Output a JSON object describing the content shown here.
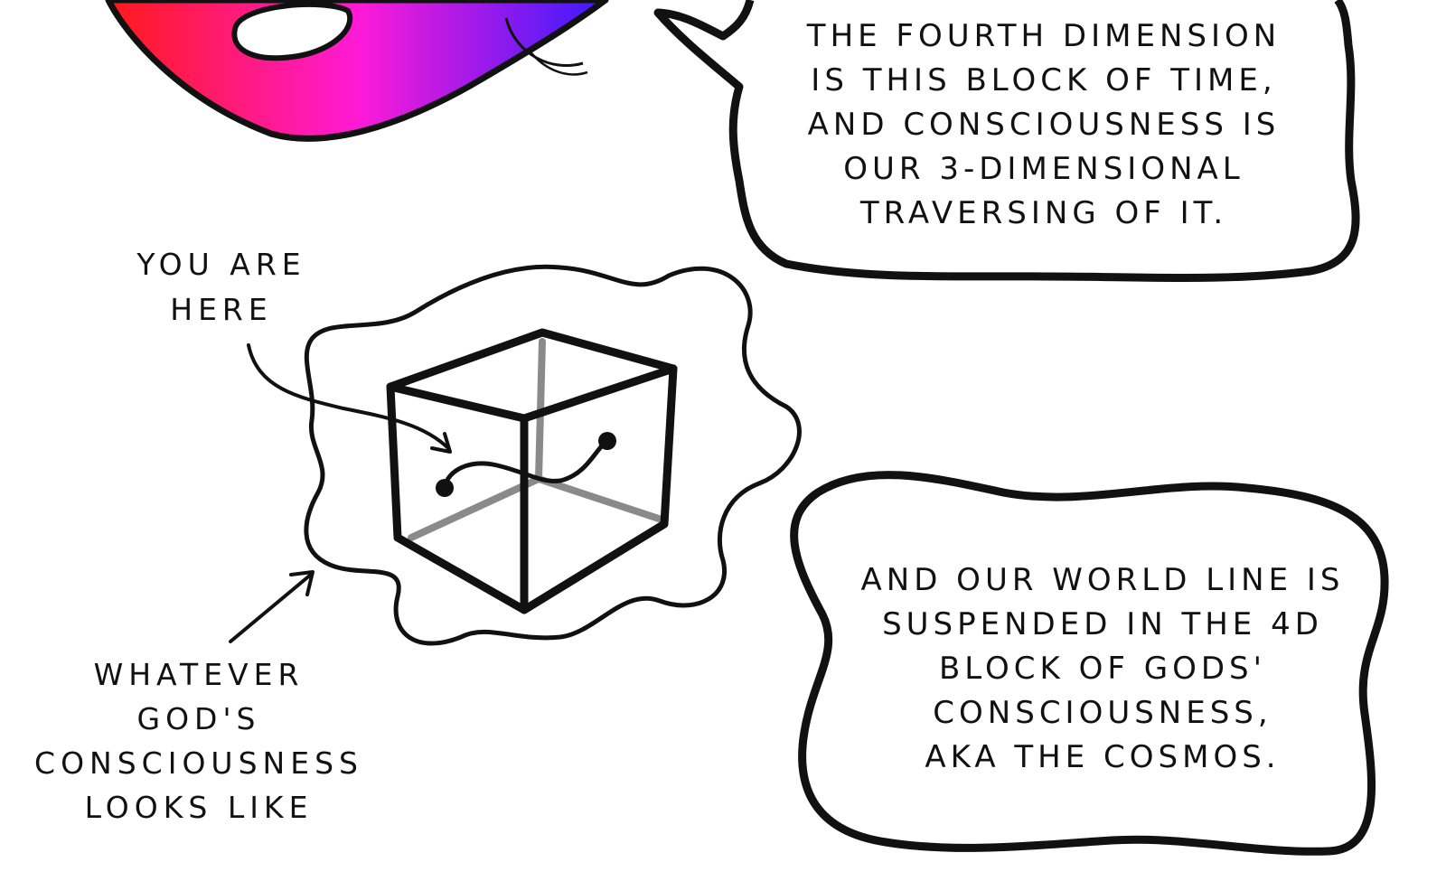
{
  "bubble_top": {
    "lines": [
      "THE FOURTH DIMENSION",
      "IS THIS BLOCK OF TIME,",
      "AND CONSCIOUSNESS IS",
      "OUR 3-DIMENSIONAL",
      "TRAVERSING OF IT."
    ]
  },
  "bubble_bottom": {
    "lines": [
      "AND OUR WORLD LINE IS",
      "SUSPENDED IN THE 4D",
      "BLOCK OF GODS'",
      "CONSCIOUSNESS,",
      "AKA THE COSMOS."
    ]
  },
  "label_you_are_here": {
    "lines": [
      "YOU ARE",
      "HERE"
    ]
  },
  "label_god_consciousness": {
    "lines": [
      "WHATEVER",
      "GOD'S",
      "CONSCIOUSNESS",
      "LOOKS LIKE"
    ]
  },
  "colors": {
    "ink": "#111111",
    "cube_hidden_edges": "#8a8a8a",
    "gradient_red": "#ff1a1a",
    "gradient_magenta": "#ff1ad6",
    "gradient_blue": "#3a1aff"
  }
}
